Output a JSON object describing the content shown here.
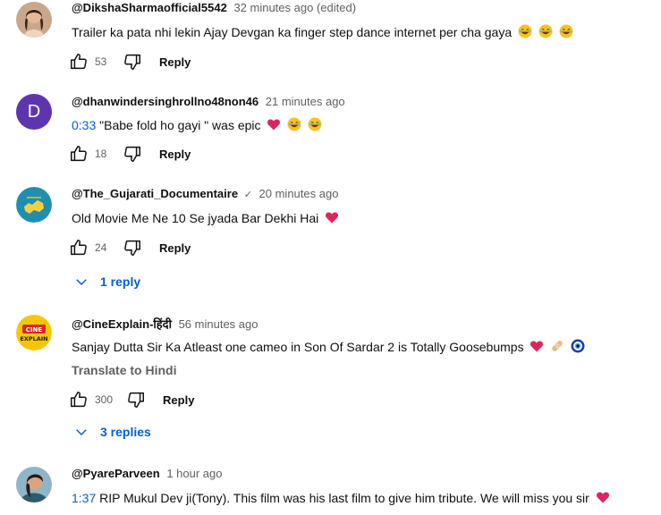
{
  "comments": [
    {
      "author": "@DikshaSharmaofficial5542",
      "time": "32 minutes ago (edited)",
      "text": "Trailer ka pata nhi lekin Ajay Devgan ka finger step dance internet per cha gaya",
      "likes": "53",
      "reply_label": "Reply",
      "avatar_icon": "woman-portrait-avatar"
    },
    {
      "author": "@dhanwindersinghrollno48non46",
      "time": "21 minutes ago",
      "timestamp": "0:33",
      "text": "\"Babe fold ho gayi \" was epic",
      "likes": "18",
      "reply_label": "Reply",
      "avatar_letter": "D",
      "avatar_color": "#5e35b1"
    },
    {
      "author": "@The_Gujarati_Documentaire",
      "time": "20 minutes ago",
      "text": "Old Movie Me Ne 10 Se jyada Bar Dekhi Hai",
      "likes": "24",
      "reply_label": "Reply",
      "replies_label": "1 reply",
      "avatar_icon": "gujarat-map-logo-avatar"
    },
    {
      "author": "@CineExplain-हिंदी",
      "time": "56 minutes ago",
      "text": "Sanjay Dutta Sir Ka Atleast one cameo in Son Of Sardar 2 is Totally Goosebumps",
      "translate_label": "Translate to Hindi",
      "likes": "300",
      "reply_label": "Reply",
      "replies_label": "3 replies",
      "avatar_icon": "cine-explain-logo-avatar",
      "avatar_text_top": "CINE",
      "avatar_text_bottom": "EXPLAIN"
    },
    {
      "author": "@PyareParveen",
      "time": "1 hour ago",
      "timestamp": "1:37",
      "text": "RIP Mukul Dev ji(Tony). This film was his last film to give him tribute. We will miss you sir",
      "avatar_icon": "painted-portrait-avatar"
    }
  ],
  "colors": {
    "link_blue": "#065fd4",
    "secondary_text": "#606060",
    "heart_red": "#e0245e"
  }
}
